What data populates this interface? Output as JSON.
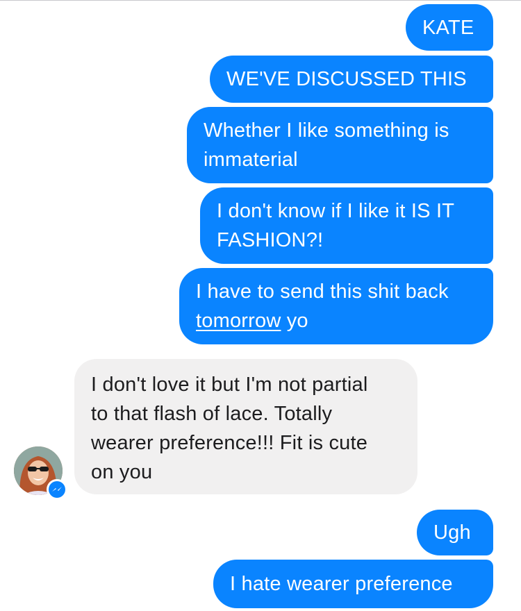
{
  "messages": [
    {
      "id": "b1",
      "sender": "me",
      "lines": [
        "KATE"
      ]
    },
    {
      "id": "b2",
      "sender": "me",
      "lines": [
        "WE'VE DISCUSSED THIS"
      ]
    },
    {
      "id": "b3",
      "sender": "me",
      "lines": [
        "Whether I like something is",
        "immaterial"
      ]
    },
    {
      "id": "b4",
      "sender": "me",
      "lines": [
        "I don't know if I like it IS IT",
        "FASHION?!"
      ]
    },
    {
      "id": "b5",
      "sender": "me",
      "line1": "I have to send this shit back",
      "link": "tomorrow",
      "after_link": " yo"
    },
    {
      "id": "b6",
      "sender": "them",
      "lines": [
        "I don't love it but I'm not partial",
        "to that flash of lace. Totally",
        "wearer preference!!! Fit is cute",
        "on you"
      ]
    },
    {
      "id": "b7",
      "sender": "me",
      "lines": [
        "Ugh"
      ]
    },
    {
      "id": "b8",
      "sender": "me",
      "lines": [
        "I hate wearer preference"
      ]
    }
  ],
  "colors": {
    "outgoing_bubble": "#0a84ff",
    "incoming_bubble": "#f1f0f0",
    "messenger_badge": "#0a84ff"
  },
  "icons": {
    "avatar": "contact-avatar-photo",
    "badge": "messenger-icon"
  }
}
